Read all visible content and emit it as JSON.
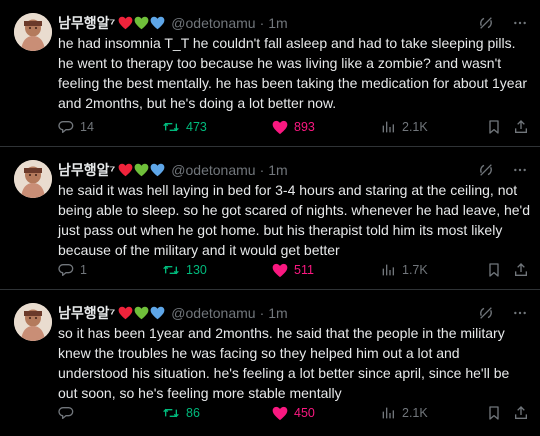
{
  "tweets": [
    {
      "name": "남무행알⁷",
      "handle": "@odetonamu",
      "dot": "·",
      "time": "1m",
      "text": "he had insomnia T_T he couldn't fall asleep and had to take sleeping pills. he went to therapy too because he was living like a zombie? and wasn't feeling the best mentally. he has been taking the medication for about 1year and 2months, but he's doing a lot better now.",
      "replies": "14",
      "retweets": "473",
      "likes": "893",
      "views": "2.1K"
    },
    {
      "name": "남무행알⁷",
      "handle": "@odetonamu",
      "dot": "·",
      "time": "1m",
      "text": "he said it was hell laying in bed for 3-4 hours and staring at the ceiling, not being able to sleep. so he got scared of nights. whenever he had leave, he'd just pass out when he got home. but his therapist told him its most likely because of the military and it would get better",
      "replies": "1",
      "retweets": "130",
      "likes": "511",
      "views": "1.7K"
    },
    {
      "name": "남무행알⁷",
      "handle": "@odetonamu",
      "dot": "·",
      "time": "1m",
      "text": "so it has been 1year and 2months. he said that the people in the military knew the troubles he was facing so they helped him out a lot and understood his situation. he's feeling a lot better since april, since he'll be out soon, so he's feeling more stable mentally",
      "replies": "",
      "retweets": "86",
      "likes": "450",
      "views": "2.1K"
    }
  ],
  "colors": {
    "background": "#000000",
    "text": "#e7e9ea",
    "muted": "#71767b",
    "retweet": "#00ba7c",
    "like": "#f91880",
    "divider": "#2f3336"
  },
  "icons": [
    "red-heart-icon",
    "green-heart-icon",
    "blue-heart-icon",
    "grok-icon",
    "more-icon",
    "reply-icon",
    "retweet-icon",
    "like-icon",
    "views-icon",
    "bookmark-icon",
    "share-icon"
  ]
}
